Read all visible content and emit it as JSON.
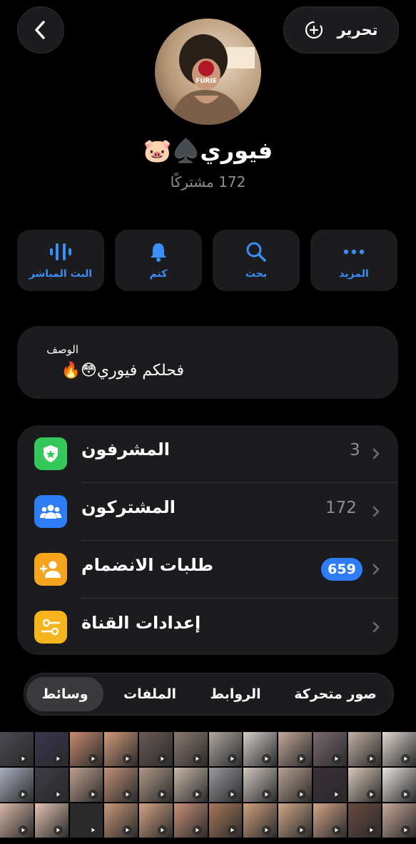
{
  "header": {
    "edit_label": "تحرير"
  },
  "channel": {
    "name": "فيوري♠️🐷",
    "subscribers": "172 مشتركًا"
  },
  "actions": [
    {
      "label": "المزيد",
      "icon": "more-icon"
    },
    {
      "label": "بحث",
      "icon": "search-icon"
    },
    {
      "label": "كتم",
      "icon": "bell-icon"
    },
    {
      "label": "البث المباشر",
      "icon": "live-stream-icon"
    }
  ],
  "description": {
    "label": "الوصف",
    "text": "فحلكم فيوري😳🔥"
  },
  "settings": [
    {
      "title": "المشرفون",
      "count": "3",
      "icon": "admin-shield-icon",
      "color": "#34c759"
    },
    {
      "title": "المشتركون",
      "count": "172",
      "icon": "members-icon",
      "color": "#2f7df6"
    },
    {
      "title": "طلبات الانضمام",
      "badge": "659",
      "icon": "add-user-icon",
      "color": "#f7a41d"
    },
    {
      "title": "إعدادات القناة",
      "icon": "channel-settings-icon",
      "color": "#f7b51d"
    }
  ],
  "tabs": [
    {
      "label": "صور متحركة"
    },
    {
      "label": "الروابط"
    },
    {
      "label": "الملفات"
    },
    {
      "label": "وسائط",
      "active": true
    }
  ],
  "media_tile_colors": [
    "#4a4a52",
    "#3a3550",
    "#c98a6e",
    "#d39a7a",
    "#6a5a55",
    "#8a7a70",
    "#b0a8a0",
    "#d4cfc8",
    "#c2a898",
    "#7a6a70",
    "#c4b0a4",
    "#e0d8d0",
    "#a8b0c0",
    "#3c3c44",
    "#bfa090",
    "#c09078",
    "#b09888",
    "#c8b8a8",
    "#9a9aa0",
    "#d0c8c0",
    "#b8a090",
    "#3a3038",
    "#d8c8b8",
    "#e8e4e0",
    "#d8b8a8",
    "#e4c4b0",
    "#2a2a2a",
    "#c89878",
    "#d4a484",
    "#c89078",
    "#a87858",
    "#d0a080",
    "#d0a888",
    "#d4a488",
    "#6a4a40",
    "#c8a898"
  ]
}
